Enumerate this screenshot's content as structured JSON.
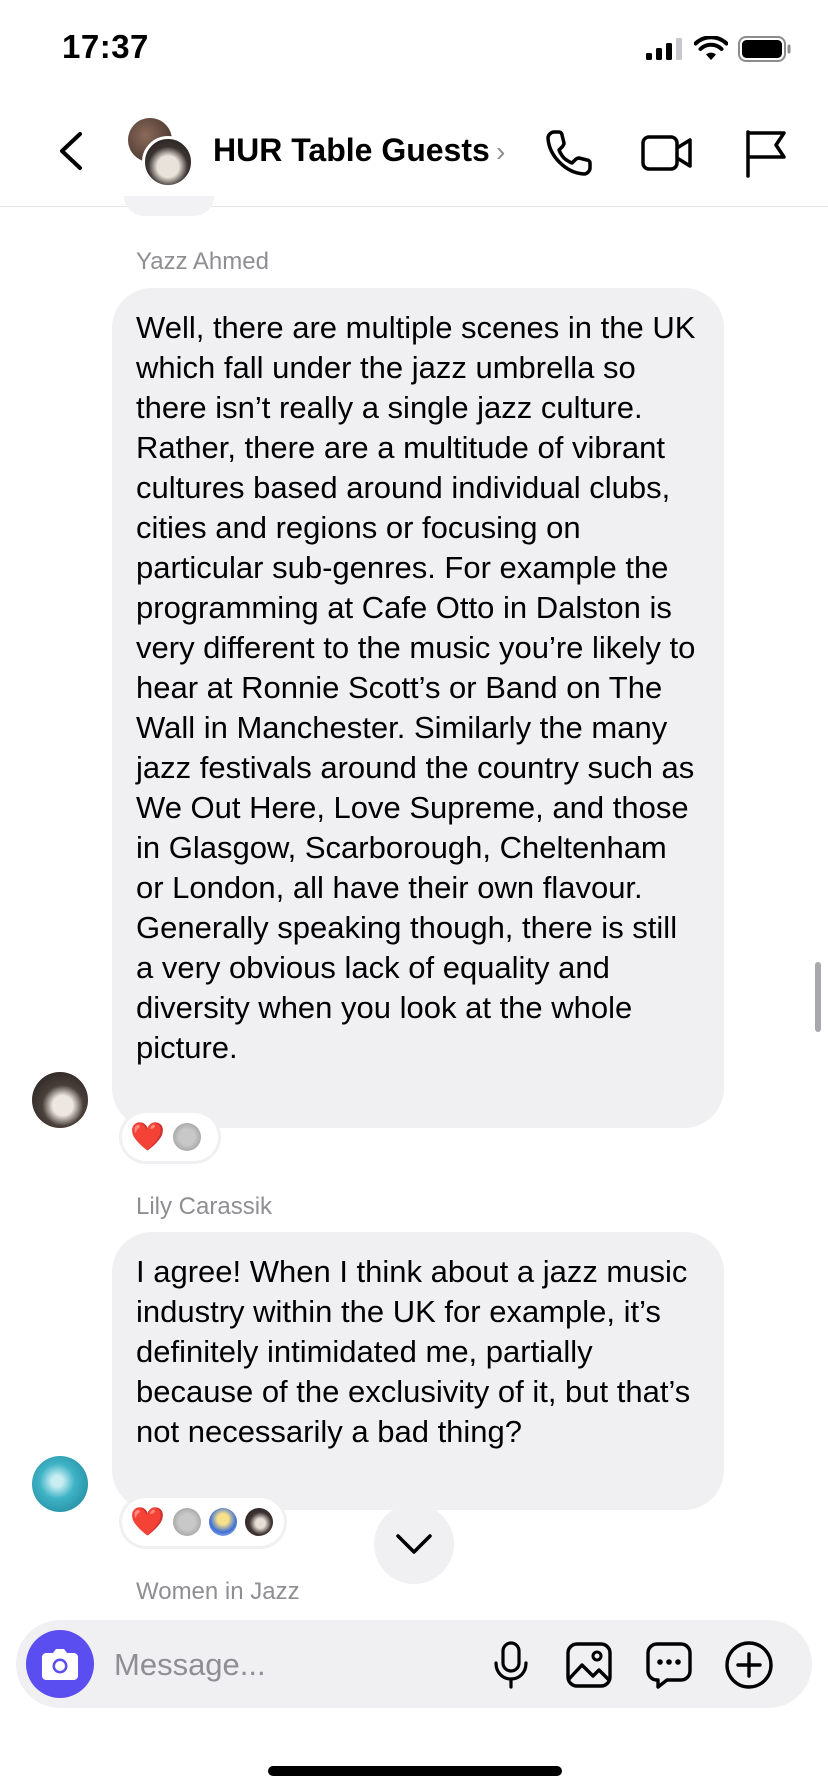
{
  "status_bar": {
    "time": "17:37"
  },
  "header": {
    "title": "HUR Table Guests",
    "chevron": "›",
    "icons": [
      "back-chevron-icon",
      "phone-icon",
      "video-call-icon",
      "flag-icon"
    ]
  },
  "messages": [
    {
      "sender": "Yazz Ahmed",
      "text": "Well, there are multiple scenes in the UK which fall under the jazz umbrella so there isn’t really a single jazz culture. Rather, there are a multitude of vibrant cultures based around individual clubs, cities and regions or focusing on particular sub-genres. For example the programming at Cafe Otto in Dalston is very different to the music you’re likely to hear at Ronnie Scott’s or Band on The Wall in Manchester. Similarly the many jazz festivals around the country such as We Out Here, Love Supreme, and those in Glasgow, Scarborough, Cheltenham or London, all have their own flavour. Generally speaking though, there is still a very obvious lack of equality and diversity when you look at the whole picture.",
      "reactions": [
        "❤️"
      ]
    },
    {
      "sender": "Lily Carassik",
      "text": "I agree! When I think about a jazz music industry within the UK for example, it’s definitely intimidated me, partially because of the exclusivity of it, but that’s not necessarily a bad thing?",
      "reactions": [
        "❤️"
      ]
    },
    {
      "sender": "Women in Jazz"
    }
  ],
  "composer": {
    "placeholder": "Message..."
  },
  "colors": {
    "accent": "#5b4ef0",
    "bubble": "#f0f0f3",
    "meta_text": "#8e8e93",
    "heart": "#e0182e"
  }
}
